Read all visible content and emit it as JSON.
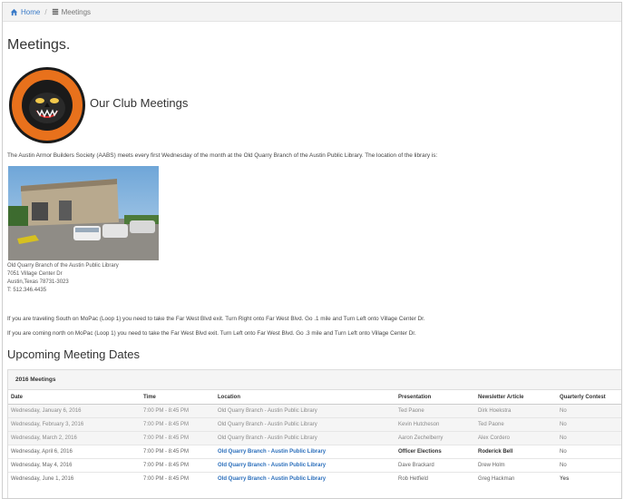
{
  "breadcrumb": {
    "home": "Home",
    "current": "Meetings"
  },
  "page_title": "Meetings.",
  "club_heading": "Our Club Meetings",
  "intro": "The Austin Armor Builders Society (AABS) meets every first Wednesday of the month at the Old Quarry Branch of the Austin Public Library. The location of the library is:",
  "address": {
    "name": "Old Quarry Branch of the Austin Public Library",
    "street": "7051 Village Center Dr",
    "city": "Austin,Texas 78731-3023",
    "phone": "T: 512.346.4435"
  },
  "directions": [
    "If you are traveling South on MoPac (Loop 1) you need to take the Far West Blvd exit. Turn Right onto Far West Blvd. Go .1 mile and Turn Left onto Village Center Dr.",
    "If you are coming north on MoPac (Loop 1) you need to take the Far West Blvd exit. Turn Left onto Far West Blvd. Go .3 mile and Turn Left onto Village Center Dr."
  ],
  "upcoming_heading": "Upcoming Meeting Dates",
  "panel_heading": "2016 Meetings",
  "table": {
    "headers": [
      "Date",
      "Time",
      "Location",
      "Presentation",
      "Newsletter Article",
      "Quarterly Contest"
    ],
    "rows": [
      {
        "past": true,
        "cells": [
          "Wednesday, January 6, 2016",
          "7:00 PM - 8:45 PM",
          "Old Quarry Branch - Austin Public Library",
          "Ted Paone",
          "Dirk Hoekstra",
          "No"
        ]
      },
      {
        "past": true,
        "cells": [
          "Wednesday, February 3, 2016",
          "7:00 PM - 8:45 PM",
          "Old Quarry Branch - Austin Public Library",
          "Kevin Hutcheson",
          "Ted Paone",
          "No"
        ]
      },
      {
        "past": true,
        "cells": [
          "Wednesday, March 2, 2016",
          "7:00 PM - 8:45 PM",
          "Old Quarry Branch - Austin Public Library",
          "Aaron Zechelberry",
          "Alex Cordero",
          "No"
        ]
      },
      {
        "past": false,
        "cells": [
          "Wednesday, April 6, 2016",
          "7:00 PM - 8:45 PM",
          "Old Quarry Branch - Austin Public Library",
          "Officer Elections",
          "Roderick Bell",
          "No"
        ]
      },
      {
        "past": false,
        "cells": [
          "Wednesday, May 4, 2016",
          "7:00 PM - 8:45 PM",
          "Old Quarry Branch - Austin Public Library",
          "Dave Brackard",
          "Drew Holm",
          "No"
        ]
      },
      {
        "past": false,
        "cells": [
          "Wednesday, June 1, 2016",
          "7:00 PM - 8:45 PM",
          "Old Quarry Branch - Austin Public Library",
          "Rob Hetfield",
          "Greg Hackman",
          "Yes"
        ]
      }
    ]
  },
  "colors": {
    "link": "#2a6ebb",
    "logo_orange": "#e8711c",
    "panel_bg": "#f5f5f5"
  },
  "icons": {
    "home": "home-icon",
    "meetings": "list-icon"
  }
}
